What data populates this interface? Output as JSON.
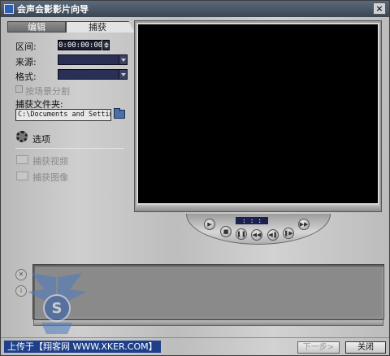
{
  "window": {
    "title": "会声会影影片向导",
    "close_glyph": "×"
  },
  "tabs": [
    {
      "label": "编辑"
    },
    {
      "label": "捕获"
    }
  ],
  "capture": {
    "duration_label": "区间:",
    "duration_value": "0:00:00:00",
    "source_label": "来源:",
    "format_label": "格式:",
    "split_by_scene_label": "按场景分割",
    "folder_label": "捕获文件夹:",
    "folder_value": "C:\\Documents and Setting",
    "options_label": "选项",
    "capture_video_label": "捕获视频",
    "capture_image_label": "捕获图像"
  },
  "player": {
    "timecode": ": : :"
  },
  "buttons": {
    "next": "下一步>",
    "close": "关闭"
  },
  "watermark": {
    "text": "上传于【翔客网 WWW.XKER.COM】"
  },
  "colors": {
    "title_bar": "#3b4552",
    "dropdown_bg": "#2a2f56",
    "preview_bg": "#000000",
    "storyboard_bg": "#8a8a8a"
  }
}
